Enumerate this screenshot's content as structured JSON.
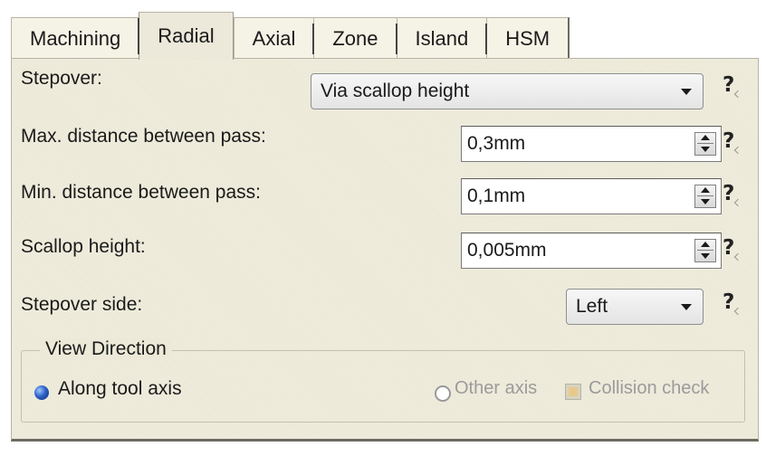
{
  "tabs": [
    {
      "label": "Machining",
      "active": false
    },
    {
      "label": "Radial",
      "active": true
    },
    {
      "label": "Axial",
      "active": false
    },
    {
      "label": "Zone",
      "active": false
    },
    {
      "label": "Island",
      "active": false
    },
    {
      "label": "HSM",
      "active": false
    }
  ],
  "stepover": {
    "label": "Stepover:",
    "value": "Via scallop height",
    "help": "?"
  },
  "max_distance": {
    "label": "Max. distance between pass:",
    "value": "0,3mm",
    "help": "?"
  },
  "min_distance": {
    "label": "Min. distance between pass:",
    "value": "0,1mm",
    "help": "?"
  },
  "scallop_height": {
    "label": "Scallop height:",
    "value": "0,005mm",
    "help": "?"
  },
  "stepover_side": {
    "label": "Stepover side:",
    "value": "Left",
    "help": "?"
  },
  "view_direction": {
    "title": "View Direction",
    "along_tool_axis": "Along tool axis",
    "other_axis": "Other axis",
    "collision_check": "Collision check"
  },
  "icons": {
    "spinner": "up-down-spinner-icon",
    "dropdown": "chevron-down-icon",
    "help": "help-question-icon"
  },
  "colors": {
    "panel_bg": "#ece9d8",
    "disabled_text": "#9b9b9b"
  }
}
